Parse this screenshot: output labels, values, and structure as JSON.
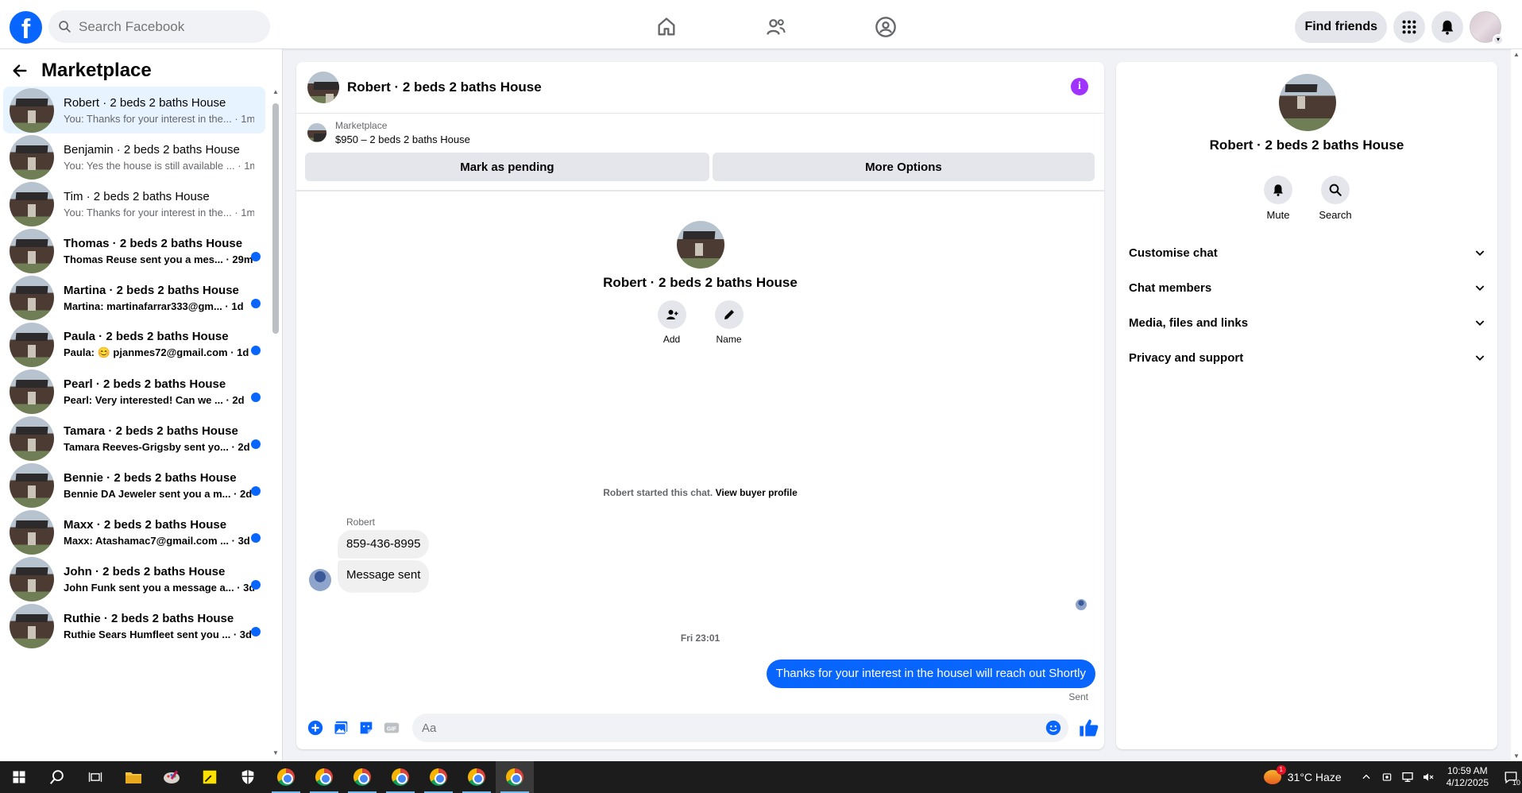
{
  "nav": {
    "search_placeholder": "Search Facebook",
    "find_friends": "Find friends"
  },
  "sidebar": {
    "title": "Marketplace",
    "conversations": [
      {
        "name": "Robert · 2 beds 2 baths House",
        "preview": "You: Thanks for your interest in the...",
        "time": "1m",
        "unread": false,
        "active": true
      },
      {
        "name": "Benjamin · 2 beds 2 baths House",
        "preview": "You: Yes the house is still available ...",
        "time": "1m",
        "unread": false,
        "active": false
      },
      {
        "name": "Tim · 2 beds 2 baths House",
        "preview": "You: Thanks for your interest in the...",
        "time": "1m",
        "unread": false,
        "active": false
      },
      {
        "name": "Thomas · 2 beds 2 baths House",
        "preview": "Thomas Reuse sent you a mes...",
        "time": "29m",
        "unread": true,
        "active": false
      },
      {
        "name": "Martina · 2 beds 2 baths House",
        "preview": "Martina: martinafarrar333@gm...",
        "time": "1d",
        "unread": true,
        "active": false
      },
      {
        "name": "Paula · 2 beds 2 baths House",
        "preview": "Paula: 😊 pjanmes72@gmail.com",
        "time": "1d",
        "unread": true,
        "active": false
      },
      {
        "name": "Pearl · 2 beds 2 baths House",
        "preview": "Pearl: Very interested! Can we ...",
        "time": "2d",
        "unread": true,
        "active": false
      },
      {
        "name": "Tamara · 2 beds 2 baths House",
        "preview": "Tamara Reeves-Grigsby sent yo...",
        "time": "2d",
        "unread": true,
        "active": false
      },
      {
        "name": "Bennie · 2 beds 2 baths House",
        "preview": "Bennie DA Jeweler sent you a m...",
        "time": "2d",
        "unread": true,
        "active": false
      },
      {
        "name": "Maxx · 2 beds 2 baths House",
        "preview": "Maxx: Atashamac7@gmail.com ...",
        "time": "3d",
        "unread": true,
        "active": false
      },
      {
        "name": "John · 2 beds 2 baths House",
        "preview": "John Funk sent you a message a...",
        "time": "3d",
        "unread": true,
        "active": false
      },
      {
        "name": "Ruthie · 2 beds 2 baths House",
        "preview": "Ruthie Sears Humfleet sent you ...",
        "time": "3d",
        "unread": true,
        "active": false
      }
    ]
  },
  "chat": {
    "title": "Robert · 2 beds 2 baths House",
    "listing_label": "Marketplace",
    "listing_price": "$950 – 2 beds 2 baths House",
    "mark_pending": "Mark as pending",
    "more_options": "More Options",
    "intro_name": "Robert · 2 beds 2 baths House",
    "add_label": "Add",
    "name_label": "Name",
    "started_text": "Robert started this chat.",
    "view_buyer": "View buyer profile",
    "sender": "Robert",
    "incoming": [
      "859-436-8995",
      "Message sent"
    ],
    "timestamp": "Fri 23:01",
    "outgoing": "Thanks for your interest in the houseI will reach out Shortly",
    "sent_label": "Sent",
    "composer_placeholder": "Aa"
  },
  "details": {
    "name": "Robert · 2 beds 2 baths House",
    "mute": "Mute",
    "search": "Search",
    "sections": [
      "Customise chat",
      "Chat members",
      "Media, files and links",
      "Privacy and support"
    ]
  },
  "taskbar": {
    "weather": "31°C  Haze",
    "weather_badge": "1",
    "time": "10:59 AM",
    "date": "4/12/2025",
    "notifications": "10"
  },
  "colors": {
    "accent": "#0866ff",
    "info": "#a033ff",
    "active_row": "#e7f3ff"
  }
}
